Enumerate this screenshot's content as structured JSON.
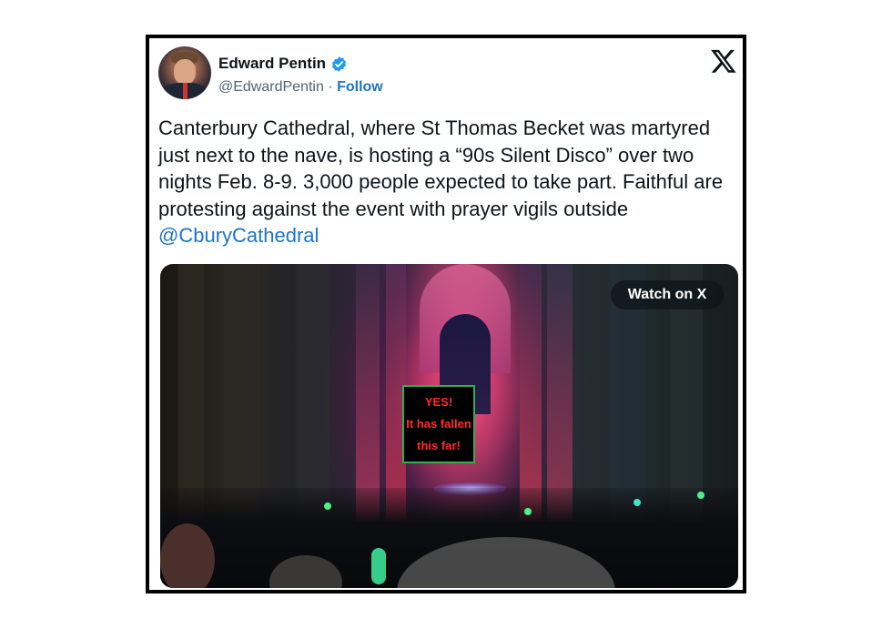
{
  "author": {
    "name": "Edward Pentin",
    "handle": "@EdwardPentin",
    "separator": "·",
    "follow_label": "Follow"
  },
  "icons": [
    "verified-badge-icon",
    "x-logo-icon"
  ],
  "colors": {
    "link": "#1d75c4",
    "verified": "#1d9bf0",
    "overlay_border": "#2fb04e",
    "overlay_text": "#ff2a2a"
  },
  "tweet": {
    "text": "Canterbury Cathedral, where St Thomas Becket was martyred just next to the nave, is hosting a “90s Silent Disco” over two nights Feb. 8-9. 3,000 people expected to take part. Faithful are protesting against the event with prayer vigils outside ",
    "mention": "@CburyCathedral"
  },
  "media": {
    "watch_label": "Watch on X",
    "overlay_lines": [
      "YES!",
      "It has fallen",
      "this far!"
    ]
  }
}
